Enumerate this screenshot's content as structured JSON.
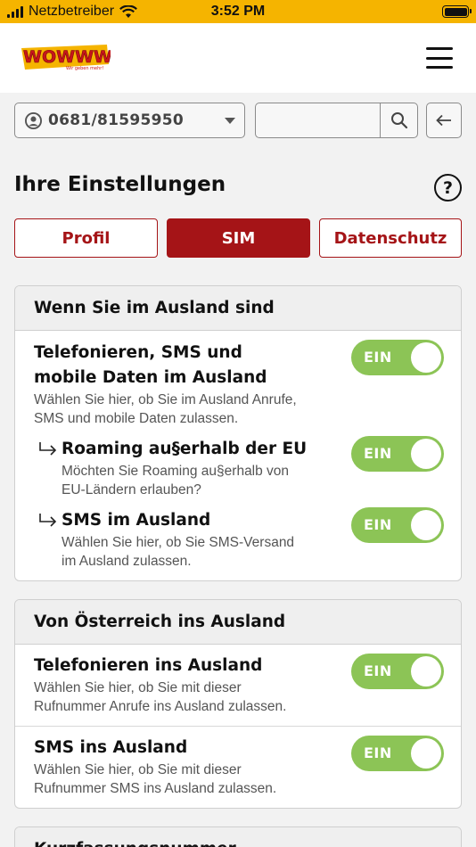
{
  "status_bar": {
    "carrier": "Netzbetreiber",
    "time": "3:52 PM"
  },
  "header": {
    "logo_text": "WOWWW!",
    "logo_tagline": "Wir geben mehr!"
  },
  "search": {
    "phone_number": "0681/81595950",
    "search_placeholder": ""
  },
  "page": {
    "title": "Ihre Einstellungen",
    "help_glyph": "?"
  },
  "tabs": [
    {
      "label": "Profil",
      "active": false
    },
    {
      "label": "SIM",
      "active": true
    },
    {
      "label": "Datenschutz",
      "active": false
    }
  ],
  "sections": [
    {
      "title": "Wenn Sie im Ausland sind",
      "items": [
        {
          "title_lines": [
            "Telefonieren, SMS und",
            "mobile Daten im Ausland"
          ],
          "desc_lines": [
            "Wählen Sie hier, ob Sie im Ausland Anrufe,",
            "SMS und mobile Daten zulassen."
          ],
          "toggle": "EIN",
          "subitems": [
            {
              "title": "Roaming au§erhalb der EU",
              "desc_lines": [
                "Möchten Sie Roaming au§erhalb von",
                "EU-Ländern erlauben?"
              ],
              "toggle": "EIN"
            },
            {
              "title": "SMS im Ausland",
              "desc_lines": [
                "Wählen Sie hier, ob Sie SMS-Versand",
                "im Ausland zulassen."
              ],
              "toggle": "EIN"
            }
          ]
        }
      ]
    },
    {
      "title": "Von Österreich ins Ausland",
      "items": [
        {
          "title_lines": [
            "Telefonieren ins Ausland"
          ],
          "desc_lines": [
            "Wählen Sie hier, ob Sie mit dieser",
            "Rufnummer Anrufe ins Ausland zulassen."
          ],
          "toggle": "EIN"
        },
        {
          "title_lines": [
            "SMS ins Ausland"
          ],
          "desc_lines": [
            "Wählen Sie hier, ob Sie mit dieser",
            "Rufnummer SMS ins Ausland zulassen."
          ],
          "toggle": "EIN"
        }
      ]
    },
    {
      "title": "Kurzfassungsnummer"
    }
  ],
  "colors": {
    "brand_yellow": "#f5b400",
    "brand_red": "#a51417",
    "toggle_on": "#8cc456"
  }
}
